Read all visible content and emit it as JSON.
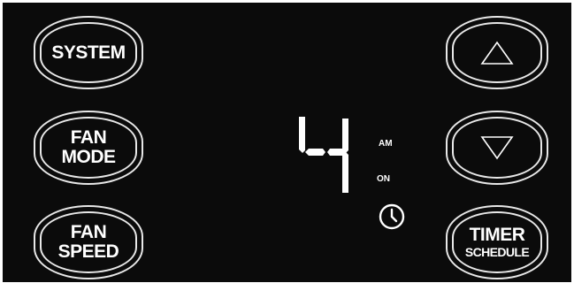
{
  "buttons": {
    "system": "SYSTEM",
    "fan_mode_line1": "FAN",
    "fan_mode_line2": "MODE",
    "fan_speed_line1": "FAN",
    "fan_speed_line2": "SPEED",
    "timer_line1": "TIMER",
    "timer_line2": "SCHEDULE"
  },
  "display": {
    "digit": "4",
    "am_indicator": "AM",
    "on_indicator": "ON"
  },
  "icons": {
    "up": "up-triangle-icon",
    "down": "down-triangle-icon",
    "clock": "clock-icon"
  },
  "colors": {
    "panel": "#0b0b0b",
    "foreground": "#ffffff"
  }
}
